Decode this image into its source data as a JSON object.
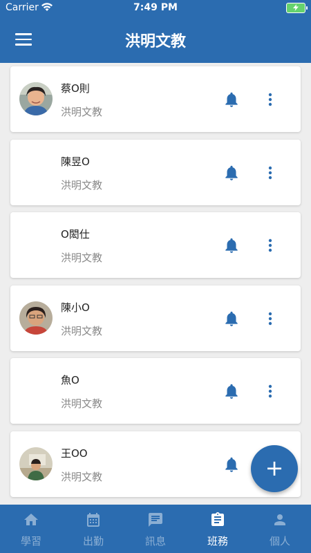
{
  "status_bar": {
    "carrier": "Carrier",
    "time": "7:49 PM"
  },
  "header": {
    "title": "洪明文教"
  },
  "students": [
    {
      "name": "蔡O則",
      "school": "洪明文教",
      "has_photo": true
    },
    {
      "name": "陳昱O",
      "school": "洪明文教",
      "has_photo": false
    },
    {
      "name": "O閎仕",
      "school": "洪明文教",
      "has_photo": false
    },
    {
      "name": "陳小O",
      "school": "洪明文教",
      "has_photo": true
    },
    {
      "name": "魚O",
      "school": "洪明文教",
      "has_photo": false
    },
    {
      "name": "王OO",
      "school": "洪明文教",
      "has_photo": true
    }
  ],
  "fab": {
    "label": "+"
  },
  "nav": {
    "items": [
      {
        "label": "學習",
        "icon": "home-icon"
      },
      {
        "label": "出勤",
        "icon": "calendar-icon"
      },
      {
        "label": "訊息",
        "icon": "message-icon"
      },
      {
        "label": "班務",
        "icon": "clipboard-icon",
        "active": true
      },
      {
        "label": "個人",
        "icon": "person-icon"
      }
    ]
  },
  "colors": {
    "primary": "#2b6cb0",
    "background": "#eeeeee",
    "muted": "#8a8a8a"
  }
}
